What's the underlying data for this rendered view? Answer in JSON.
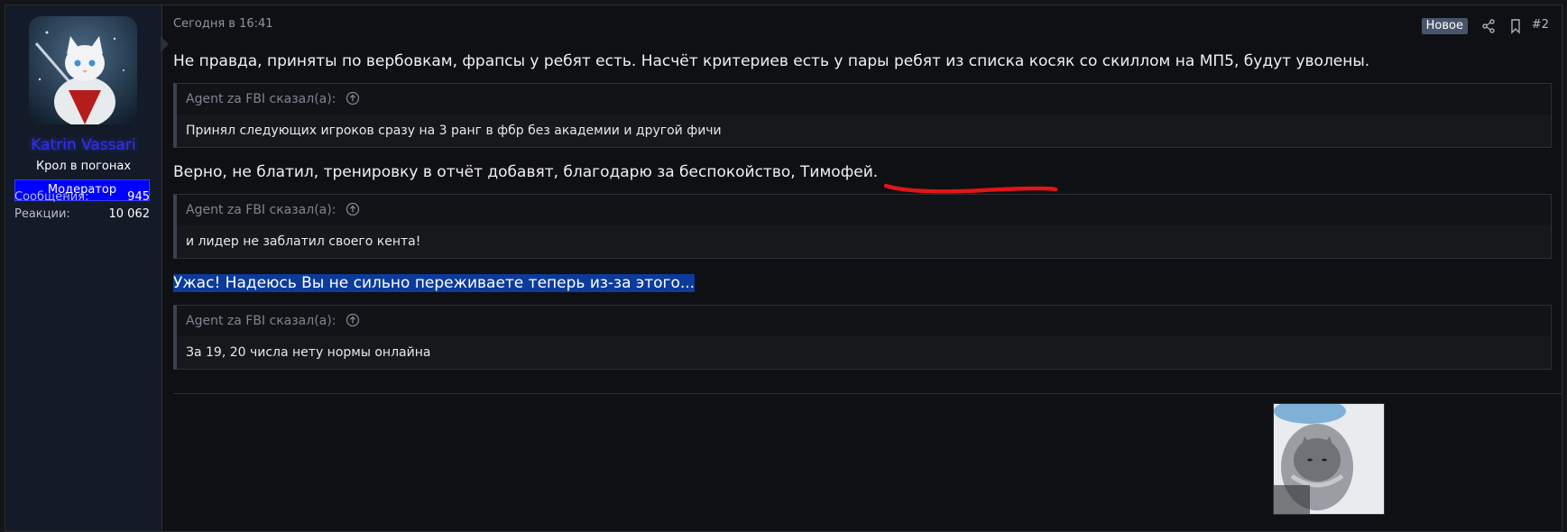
{
  "user": {
    "name": "Katrin Vassari",
    "title": "Крол в погонах",
    "role": "Модератор",
    "stats": [
      {
        "label": "Сообщения:",
        "value": "945"
      },
      {
        "label": "Реакции:",
        "value": "10 062"
      }
    ]
  },
  "post": {
    "date": "Сегодня в 16:41",
    "badge": "Новое",
    "number": "#2",
    "blocks": [
      {
        "text": "Не правда, приняты по вербовкам, фрапсы у ребят есть. Насчёт критериев есть у пары ребят из списка косяк со скиллом на МП5, будут уволены."
      },
      {
        "quote_author": "Agent za FBI сказал(а):",
        "quote_text": "Принял следующих игроков сразу на 3 ранг в фбр без академии и другой фичи"
      },
      {
        "text": "Верно, не блатил, тренировку в отчёт добавят, благодарю за беспокойство, Тимофей."
      },
      {
        "quote_author": "Agent za FBI сказал(а):",
        "quote_text": "и лидер не заблатил своего кента!"
      },
      {
        "text": "Ужас! Надеюсь Вы не сильно переживаете теперь из-за этого..."
      },
      {
        "quote_author": "Agent za FBI сказал(а):",
        "quote_text": "За 19, 20 числа нету нормы онлайна"
      }
    ]
  },
  "colors": {
    "username": "#2e2eff",
    "role_badge": "#0000ff",
    "new_badge": "#47546b",
    "selection": "#0c3b9a",
    "annotation": "#e01515"
  },
  "icons": [
    "share-icon",
    "bookmark-icon",
    "arrow-up-circle-icon"
  ]
}
